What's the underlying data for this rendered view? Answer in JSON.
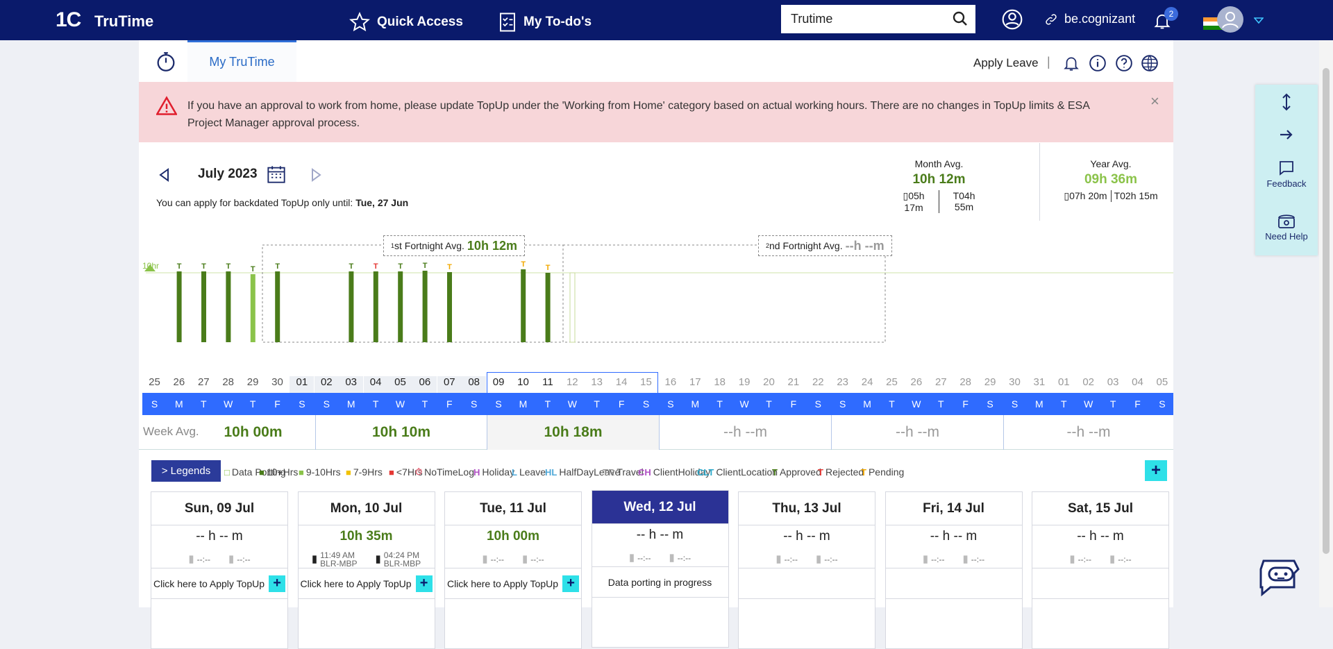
{
  "topbar": {
    "logo": "1C",
    "app_name": "TruTime",
    "quick_access": "Quick Access",
    "todo": "My To-do's",
    "search_value": "Trutime",
    "be_cognizant": "be.cognizant",
    "notif_count": "2"
  },
  "tabbar": {
    "tab": "My TruTime",
    "apply_leave": "Apply Leave",
    "sep": "|"
  },
  "alert": {
    "message": "If you have an approval to work from home, please update TopUp under the 'Working from Home' category based on actual working hours. There are no changes in TopUp limits & ESA Project Manager approval process.",
    "close": "×"
  },
  "period": {
    "month": "July 2023",
    "backdated_prefix": "You can apply for backdated TopUp only until:",
    "backdated_date": "Tue, 27 Jun"
  },
  "month_avg": {
    "label": "Month Avg.",
    "value": "10h 12m",
    "office": "05h 17m",
    "topup_prefix": "T",
    "topup": "04h 55m"
  },
  "year_avg": {
    "label": "Year Avg.",
    "value": "09h 36m",
    "office": "07h 20m",
    "topup_prefix": "T",
    "topup": "02h 15m"
  },
  "chart": {
    "ref_label": "10hr",
    "f1_label": "st Fortnight Avg.",
    "f1_sup": "1",
    "f1_value": "10h 12m",
    "f2_label": "nd Fortnight Avg.",
    "f2_sup": "2",
    "f2_value": "--h --m"
  },
  "days": [
    "25",
    "26",
    "27",
    "28",
    "29",
    "30",
    "01",
    "02",
    "03",
    "04",
    "05",
    "06",
    "07",
    "08",
    "09",
    "10",
    "11",
    "12",
    "13",
    "14",
    "15",
    "16",
    "17",
    "18",
    "19",
    "20",
    "21",
    "22",
    "23",
    "24",
    "25",
    "26",
    "27",
    "28",
    "29",
    "30",
    "31",
    "01",
    "02",
    "03",
    "04",
    "05"
  ],
  "weekdays": [
    "S",
    "M",
    "T",
    "W",
    "T",
    "F",
    "S",
    "S",
    "M",
    "T",
    "W",
    "T",
    "F",
    "S",
    "S",
    "M",
    "T",
    "W",
    "T",
    "F",
    "S",
    "S",
    "M",
    "T",
    "W",
    "T",
    "F",
    "S",
    "S",
    "M",
    "T",
    "W",
    "T",
    "F",
    "S",
    "S",
    "M",
    "T",
    "W",
    "T",
    "F",
    "S"
  ],
  "bars": [
    {
      "day": "26",
      "hours": 10.2,
      "status": "T",
      "color": "#4a7c1a",
      "tcolor": "#4a7c1a"
    },
    {
      "day": "27",
      "hours": 10.2,
      "status": "T",
      "color": "#4a7c1a",
      "tcolor": "#4a7c1a"
    },
    {
      "day": "28",
      "hours": 10.2,
      "status": "T",
      "color": "#4a7c1a",
      "tcolor": "#4a7c1a"
    },
    {
      "day": "29",
      "hours": 9.8,
      "status": "T",
      "color": "#8bc34a",
      "tcolor": "#4a7c1a"
    },
    {
      "day": "30",
      "hours": 10.2,
      "status": "T",
      "color": "#4a7c1a",
      "tcolor": "#4a7c1a"
    },
    {
      "day": "03",
      "hours": 10.2,
      "status": "T",
      "color": "#4a7c1a",
      "tcolor": "#4a7c1a"
    },
    {
      "day": "04",
      "hours": 10.2,
      "status": "T",
      "color": "#4a7c1a",
      "tcolor": "#e53935"
    },
    {
      "day": "05",
      "hours": 10.2,
      "status": "T",
      "color": "#4a7c1a",
      "tcolor": "#4a7c1a"
    },
    {
      "day": "06",
      "hours": 10.3,
      "status": "T",
      "color": "#4a7c1a",
      "tcolor": "#4a7c1a"
    },
    {
      "day": "07",
      "hours": 10.1,
      "status": "T",
      "color": "#4a7c1a",
      "tcolor": "#f2a900"
    },
    {
      "day": "10",
      "hours": 10.5,
      "status": "T",
      "color": "#4a7c1a",
      "tcolor": "#f2a900"
    },
    {
      "day": "11",
      "hours": 10.0,
      "status": "T",
      "color": "#4a7c1a",
      "tcolor": "#f2a900"
    },
    {
      "day": "12",
      "hours": 10.0,
      "status": "",
      "color": "none",
      "tcolor": "#fff"
    }
  ],
  "week_avg": {
    "label": "Week Avg.",
    "values": [
      "10h 00m",
      "10h 10m",
      "10h 18m",
      "--h --m",
      "--h --m",
      "--h --m"
    ]
  },
  "legend": {
    "button": "> Legends",
    "items": [
      {
        "mark": "□",
        "label": "Data Porting",
        "color": "#8bc34a"
      },
      {
        "mark": "■",
        "label": "10+Hrs",
        "color": "#4a7c1a"
      },
      {
        "mark": "■",
        "label": "9-10Hrs",
        "color": "#8bc34a"
      },
      {
        "mark": "■",
        "label": "7-9Hrs",
        "color": "#f2c200"
      },
      {
        "mark": "■",
        "label": "<7Hrs",
        "color": "#e53935"
      },
      {
        "mark": "⏱",
        "label": "NoTimeLog",
        "color": "#e56a7a"
      },
      {
        "mark": "H",
        "label": "Holiday",
        "color": "#b04fc4"
      },
      {
        "mark": "L",
        "label": "Leave",
        "color": "#4fa8d8"
      },
      {
        "mark": "HL",
        "label": "HalfDayLeave",
        "color": "#4fa8d8"
      },
      {
        "mark": "TR",
        "label": "Travel",
        "color": "#999999"
      },
      {
        "mark": "CH",
        "label": "ClientHoliday",
        "color": "#b04fc4"
      },
      {
        "mark": "CLT",
        "label": "ClientLocation",
        "color": "#2aa7c9"
      },
      {
        "mark": "T",
        "label": "Approved",
        "color": "#4a7c1a"
      },
      {
        "mark": "T",
        "label": "Rejected",
        "color": "#e53935"
      },
      {
        "mark": "T",
        "label": "Pending",
        "color": "#f2a900"
      }
    ]
  },
  "cards": [
    {
      "date": "Sun, 09 Jul",
      "hours": "-- h -- m",
      "in": "--:--",
      "out": "--:--",
      "action": "Click here to Apply TopUp"
    },
    {
      "date": "Mon, 10 Jul",
      "hours": "10h 35m",
      "in": "11:49 AM",
      "in_loc": "BLR-MBP",
      "out": "04:24 PM",
      "out_loc": "BLR-MBP",
      "action": "Click here to Apply TopUp"
    },
    {
      "date": "Tue, 11 Jul",
      "hours": "10h 00m",
      "in": "--:--",
      "out": "--:--",
      "action": "Click here to Apply TopUp"
    },
    {
      "date": "Wed, 12 Jul",
      "hours": "-- h -- m",
      "in": "--:--",
      "out": "--:--",
      "action": "Data porting in progress"
    },
    {
      "date": "Thu, 13 Jul",
      "hours": "-- h -- m",
      "in": "--:--",
      "out": "--:--",
      "action": ""
    },
    {
      "date": "Fri, 14 Jul",
      "hours": "-- h -- m",
      "in": "--:--",
      "out": "--:--",
      "action": ""
    },
    {
      "date": "Sat, 15 Jul",
      "hours": "-- h -- m",
      "in": "--:--",
      "out": "--:--",
      "action": ""
    }
  ],
  "right_panel": {
    "feedback": "Feedback",
    "need_help": "Need Help"
  }
}
